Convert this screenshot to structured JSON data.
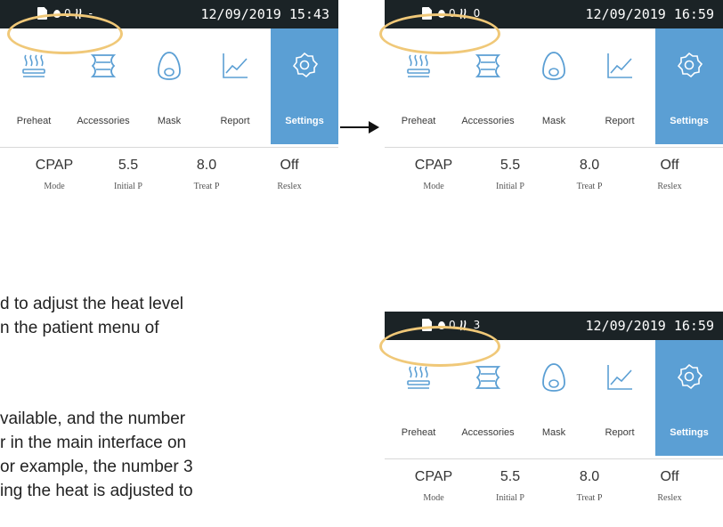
{
  "screens": [
    {
      "status": {
        "heat_level": "-",
        "datetime": "12/09/2019 15:43"
      },
      "menu": [
        "Preheat",
        "Accessories",
        "Mask",
        "Report",
        "Settings"
      ],
      "params": [
        {
          "value": "CPAP",
          "name": "Mode"
        },
        {
          "value": "5.5",
          "name": "Initial P"
        },
        {
          "value": "8.0",
          "name": "Treat P"
        },
        {
          "value": "Off",
          "name": "Reslex"
        }
      ]
    },
    {
      "status": {
        "heat_level": "0",
        "datetime": "12/09/2019 16:59"
      },
      "menu": [
        "Preheat",
        "Accessories",
        "Mask",
        "Report",
        "Settings"
      ],
      "params": [
        {
          "value": "CPAP",
          "name": "Mode"
        },
        {
          "value": "5.5",
          "name": "Initial P"
        },
        {
          "value": "8.0",
          "name": "Treat P"
        },
        {
          "value": "Off",
          "name": "Reslex"
        }
      ]
    },
    {
      "status": {
        "heat_level": "3",
        "datetime": "12/09/2019 16:59"
      },
      "menu": [
        "Preheat",
        "Accessories",
        "Mask",
        "Report",
        "Settings"
      ],
      "params": [
        {
          "value": "CPAP",
          "name": "Mode"
        },
        {
          "value": "5.5",
          "name": "Initial P"
        },
        {
          "value": "8.0",
          "name": "Treat P"
        },
        {
          "value": "Off",
          "name": "Reslex"
        }
      ]
    }
  ],
  "status_prefix": "0",
  "caption": [
    "d to adjust the heat level",
    "n the patient menu of",
    "",
    "vailable, and the number",
    "r in the main interface on",
    "or example, the number 3",
    "ing the heat is adjusted to"
  ],
  "colors": {
    "statusbar": "#1b2326",
    "settings_bg": "#5b9fd4",
    "highlight": "#f0c878",
    "icon_stroke": "#5b9fd4"
  },
  "icons": [
    "sd-card-icon",
    "water-drop-icon",
    "heater-icon",
    "preheat-icon",
    "accessories-icon",
    "mask-icon",
    "report-icon",
    "settings-gear-icon"
  ]
}
